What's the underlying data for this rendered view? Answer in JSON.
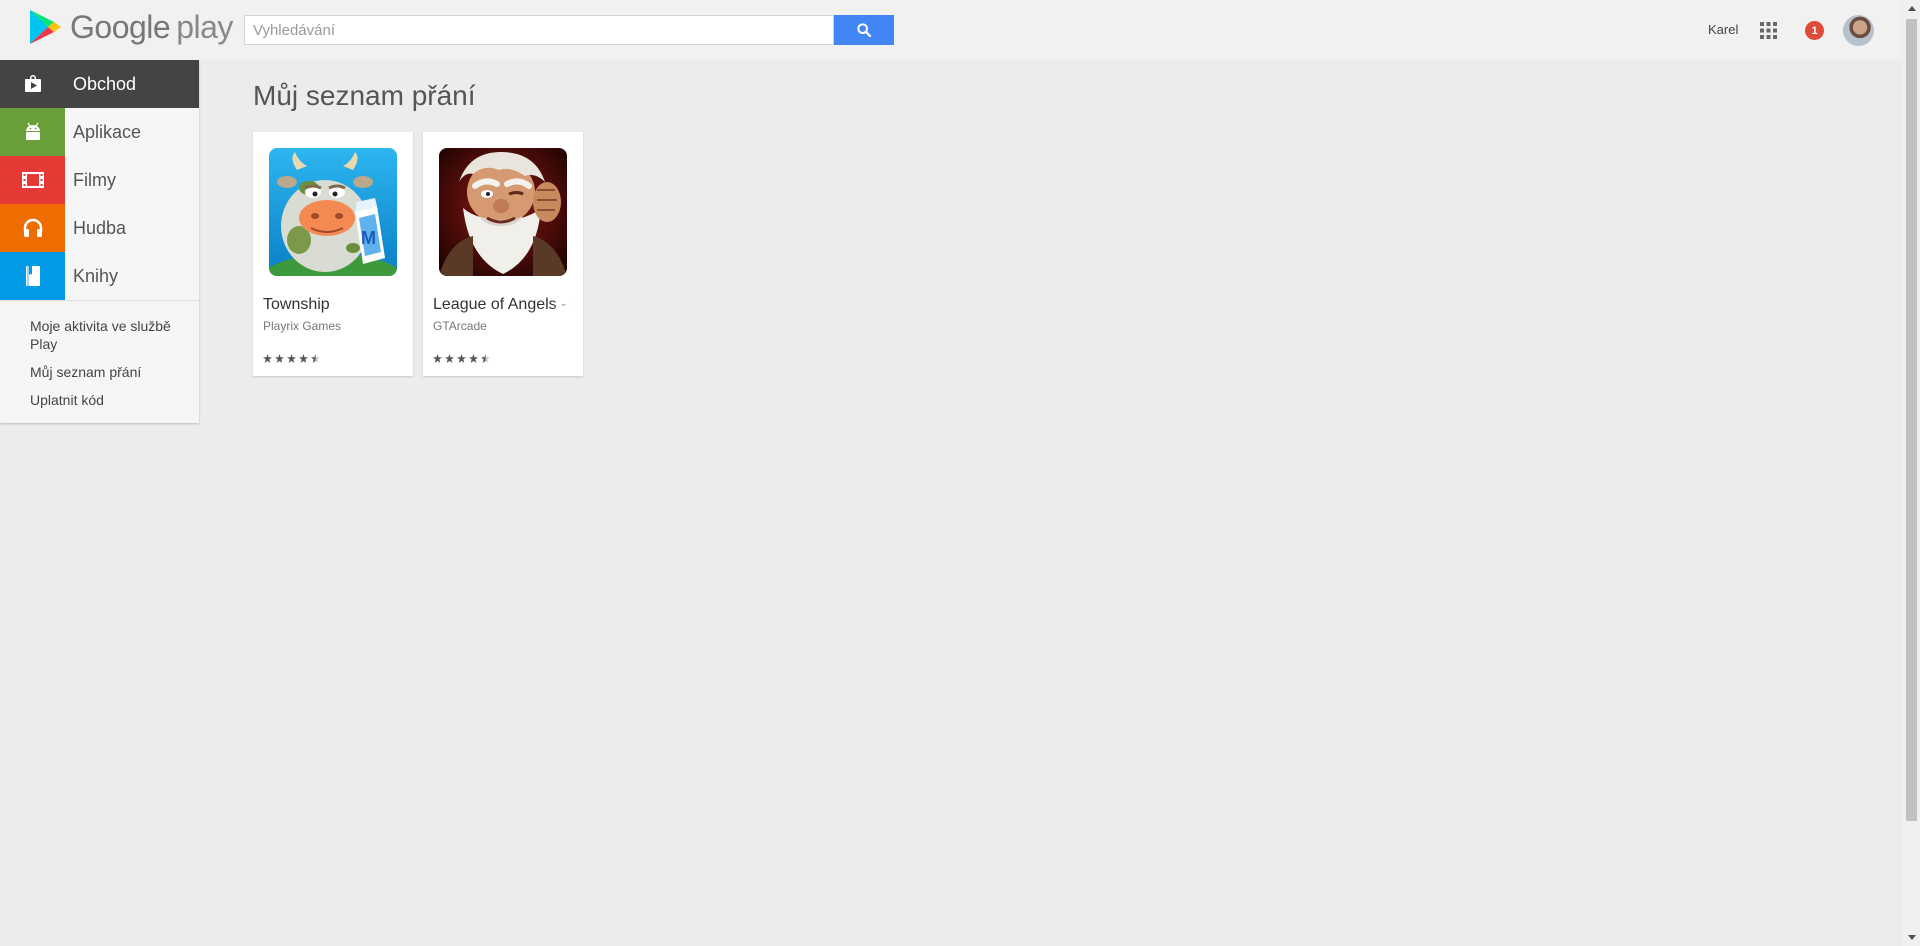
{
  "header": {
    "logo_text_google": "Google",
    "logo_text_play": "play",
    "search_placeholder": "Vyhledávání",
    "user_name": "Karel",
    "notification_count": "1"
  },
  "sidebar": {
    "items": [
      {
        "label": "Obchod",
        "color": "#444444",
        "icon": "shopping-bag-icon"
      },
      {
        "label": "Aplikace",
        "color": "#689f38",
        "icon": "android-icon"
      },
      {
        "label": "Filmy",
        "color": "#e53935",
        "icon": "film-icon"
      },
      {
        "label": "Hudba",
        "color": "#ef6c00",
        "icon": "headphones-icon"
      },
      {
        "label": "Knihy",
        "color": "#039be5",
        "icon": "book-icon"
      }
    ],
    "links": [
      "Moje aktivita ve službě Play",
      "Můj seznam přání",
      "Uplatnit kód"
    ]
  },
  "main": {
    "title": "Můj seznam přání",
    "cards": [
      {
        "title": "Township",
        "developer": "Playrix Games",
        "rating": 4.5
      },
      {
        "title": "League of Angels - I",
        "developer": "GTArcade",
        "rating": 4.5
      }
    ]
  }
}
